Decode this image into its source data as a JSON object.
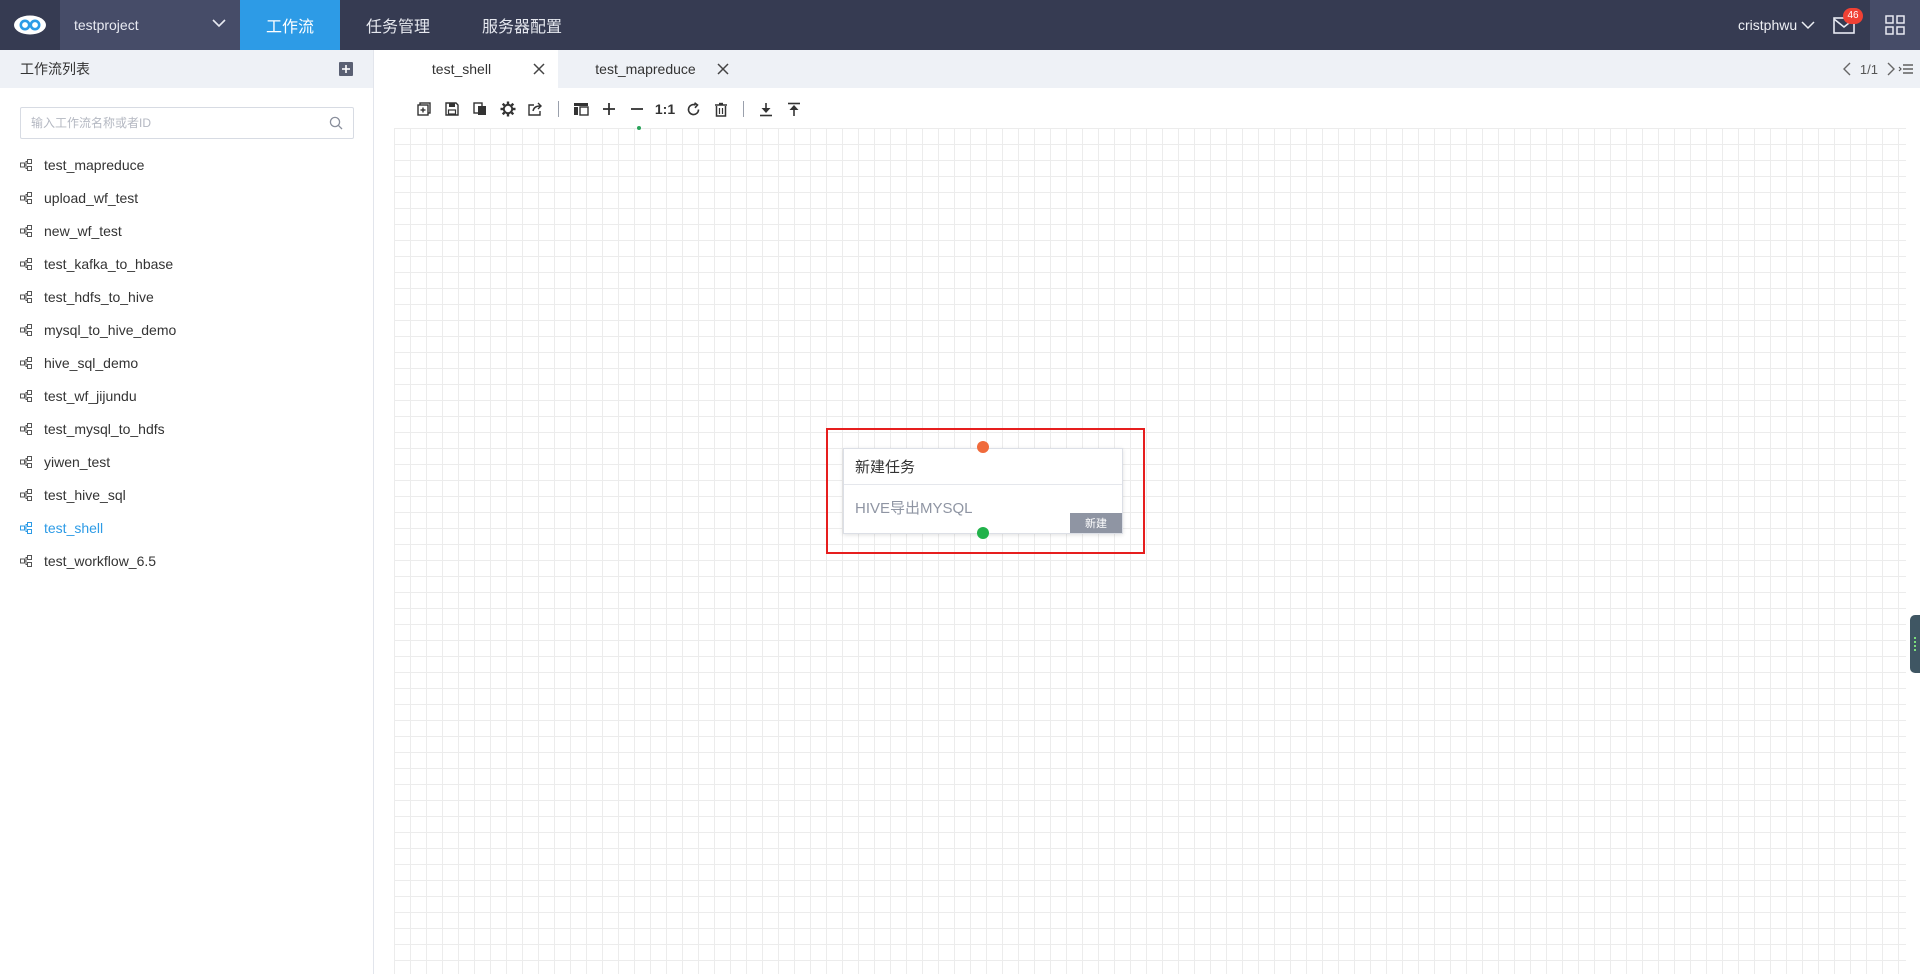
{
  "header": {
    "project_name": "testproject",
    "nav": [
      "工作流",
      "任务管理",
      "服务器配置"
    ],
    "username": "cristphwu",
    "mail_count": "46"
  },
  "sidebar": {
    "title": "工作流列表",
    "search_placeholder": "输入工作流名称或者ID",
    "workflows": [
      "test_mapreduce",
      "upload_wf_test",
      "new_wf_test",
      "test_kafka_to_hbase",
      "test_hdfs_to_hive",
      "mysql_to_hive_demo",
      "hive_sql_demo",
      "test_wf_jijundu",
      "test_mysql_to_hdfs",
      "yiwen_test",
      "test_hive_sql",
      "test_shell",
      "test_workflow_6.5"
    ],
    "active_workflow": "test_shell"
  },
  "tabs": [
    {
      "label": "test_shell",
      "active": true
    },
    {
      "label": "test_mapreduce",
      "active": false
    }
  ],
  "pager": {
    "text": "1/1"
  },
  "toolbar": {
    "zoom_reset_label": "1:1"
  },
  "canvas": {
    "node": {
      "title": "新建任务",
      "subtitle": "HIVE导出MYSQL",
      "tag": "新建"
    }
  },
  "colors": {
    "topbar": "#363b52",
    "accent": "#2d9be6",
    "highlight": "#e61e1e",
    "port_in": "#f06a3b",
    "port_out": "#21b24a"
  }
}
